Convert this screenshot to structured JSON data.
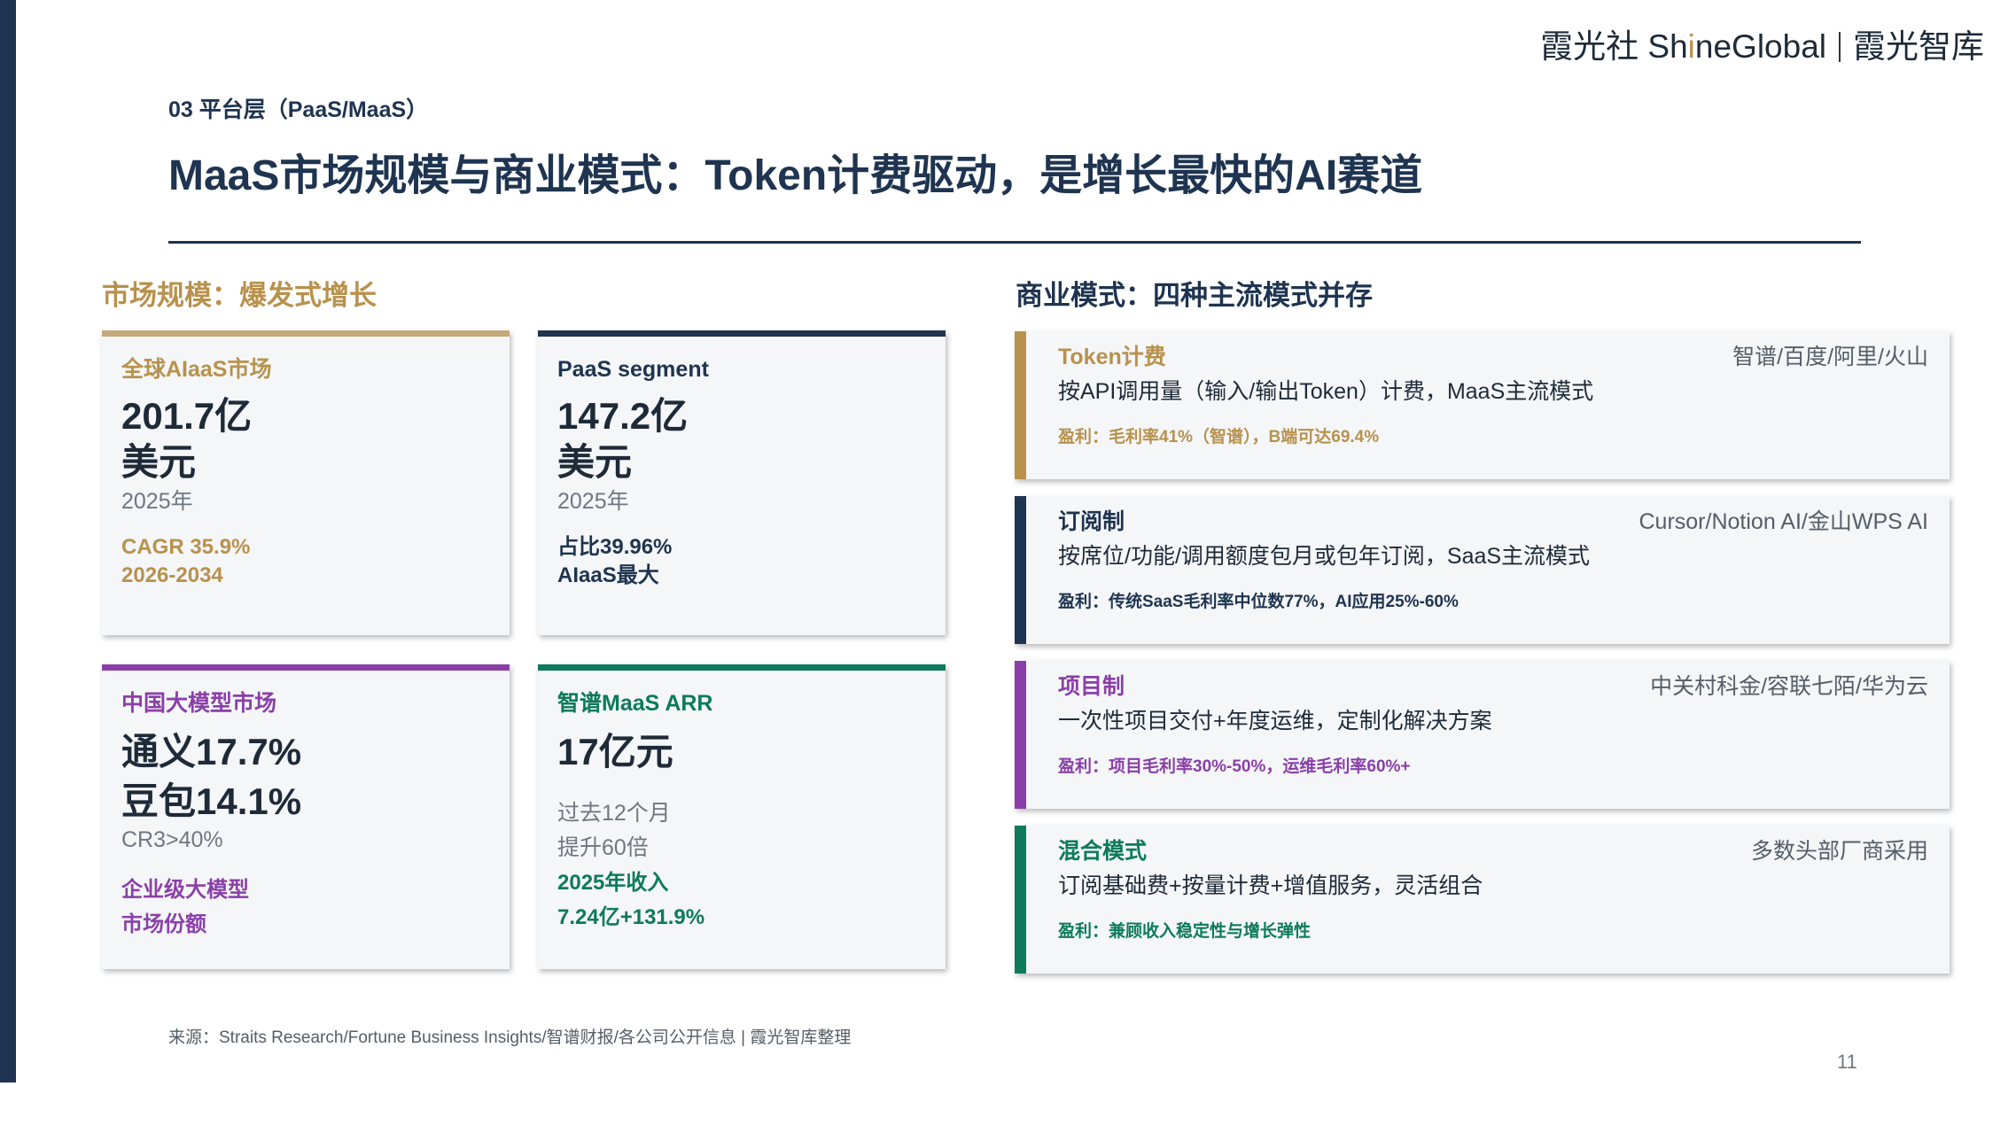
{
  "brand": {
    "part1": "霞光社 Sh",
    "hi": "i",
    "part2": "neGlobal",
    "part3": "霞光智库"
  },
  "section_label": "03 平台层（PaaS/MaaS）",
  "title": "MaaS市场规模与商业模式：Token计费驱动，是增长最快的AI赛道",
  "left_heading": "市场规模：爆发式增长",
  "right_heading": "商业模式：四种主流模式并存",
  "cards": [
    {
      "label": "全球AIaaS市场",
      "value_line1": "201.7亿",
      "value_line2": "美元",
      "year": "2025年",
      "note_line1": "CAGR 35.9%",
      "note_line2": "2026-2034",
      "accent": "#c4a878"
    },
    {
      "label": "PaaS segment",
      "value_line1": "147.2亿",
      "value_line2": "美元",
      "year": "2025年",
      "note_line1": "占比39.96%",
      "note_line2": "AIaaS最大",
      "accent": "#1e3450"
    },
    {
      "label": "中国大模型市场",
      "value_line1": "通义17.7%",
      "value_line2": "豆包14.1%",
      "year": "CR3>40%",
      "note_line1": "企业级大模型",
      "note_line2": "市场份额",
      "accent": "#8a3fa8"
    },
    {
      "label": "智谱MaaS ARR",
      "value_line1": "17亿元",
      "sub_line1": "过去12个月",
      "sub_line2": "提升60倍",
      "note_line1": "2025年收入",
      "note_line2": "7.24亿+131.9%",
      "accent": "#0d7a5b"
    }
  ],
  "models": [
    {
      "name": "Token计费",
      "who": "智谱/百度/阿里/火山",
      "desc": "按API调用量（输入/输出Token）计费，MaaS主流模式",
      "profit": "盈利：毛利率41%（智谱），B端可达69.4%",
      "accent": "#b8914c"
    },
    {
      "name": "订阅制",
      "who": "Cursor/Notion AI/金山WPS AI",
      "desc": "按席位/功能/调用额度包月或包年订阅，SaaS主流模式",
      "profit": "盈利：传统SaaS毛利率中位数77%，AI应用25%-60%",
      "accent": "#1e3450"
    },
    {
      "name": "项目制",
      "who": "中关村科金/容联七陌/华为云",
      "desc": "一次性项目交付+年度运维，定制化解决方案",
      "profit": "盈利：项目毛利率30%-50%，运维毛利率60%+",
      "accent": "#8a3fa8"
    },
    {
      "name": "混合模式",
      "who": "多数头部厂商采用",
      "desc": "订阅基础费+按量计费+增值服务，灵活组合",
      "profit": "盈利：兼顾收入稳定性与增长弹性",
      "accent": "#0d7a5b"
    }
  ],
  "source": "来源：Straits Research/Fortune Business Insights/智谱财报/各公司公开信息 | 霞光智库整理",
  "page_number": "11"
}
